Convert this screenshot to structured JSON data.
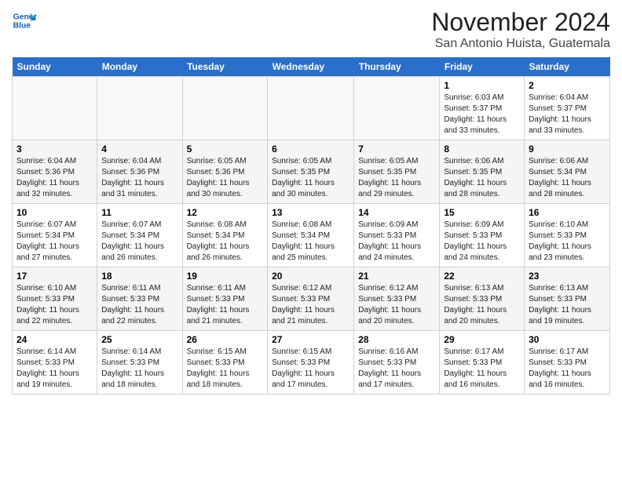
{
  "header": {
    "logo_line1": "General",
    "logo_line2": "Blue",
    "title": "November 2024",
    "subtitle": "San Antonio Huista, Guatemala"
  },
  "weekdays": [
    "Sunday",
    "Monday",
    "Tuesday",
    "Wednesday",
    "Thursday",
    "Friday",
    "Saturday"
  ],
  "weeks": [
    [
      {
        "day": "",
        "info": ""
      },
      {
        "day": "",
        "info": ""
      },
      {
        "day": "",
        "info": ""
      },
      {
        "day": "",
        "info": ""
      },
      {
        "day": "",
        "info": ""
      },
      {
        "day": "1",
        "info": "Sunrise: 6:03 AM\nSunset: 5:37 PM\nDaylight: 11 hours and 33 minutes."
      },
      {
        "day": "2",
        "info": "Sunrise: 6:04 AM\nSunset: 5:37 PM\nDaylight: 11 hours and 33 minutes."
      }
    ],
    [
      {
        "day": "3",
        "info": "Sunrise: 6:04 AM\nSunset: 5:36 PM\nDaylight: 11 hours and 32 minutes."
      },
      {
        "day": "4",
        "info": "Sunrise: 6:04 AM\nSunset: 5:36 PM\nDaylight: 11 hours and 31 minutes."
      },
      {
        "day": "5",
        "info": "Sunrise: 6:05 AM\nSunset: 5:36 PM\nDaylight: 11 hours and 30 minutes."
      },
      {
        "day": "6",
        "info": "Sunrise: 6:05 AM\nSunset: 5:35 PM\nDaylight: 11 hours and 30 minutes."
      },
      {
        "day": "7",
        "info": "Sunrise: 6:05 AM\nSunset: 5:35 PM\nDaylight: 11 hours and 29 minutes."
      },
      {
        "day": "8",
        "info": "Sunrise: 6:06 AM\nSunset: 5:35 PM\nDaylight: 11 hours and 28 minutes."
      },
      {
        "day": "9",
        "info": "Sunrise: 6:06 AM\nSunset: 5:34 PM\nDaylight: 11 hours and 28 minutes."
      }
    ],
    [
      {
        "day": "10",
        "info": "Sunrise: 6:07 AM\nSunset: 5:34 PM\nDaylight: 11 hours and 27 minutes."
      },
      {
        "day": "11",
        "info": "Sunrise: 6:07 AM\nSunset: 5:34 PM\nDaylight: 11 hours and 26 minutes."
      },
      {
        "day": "12",
        "info": "Sunrise: 6:08 AM\nSunset: 5:34 PM\nDaylight: 11 hours and 26 minutes."
      },
      {
        "day": "13",
        "info": "Sunrise: 6:08 AM\nSunset: 5:34 PM\nDaylight: 11 hours and 25 minutes."
      },
      {
        "day": "14",
        "info": "Sunrise: 6:09 AM\nSunset: 5:33 PM\nDaylight: 11 hours and 24 minutes."
      },
      {
        "day": "15",
        "info": "Sunrise: 6:09 AM\nSunset: 5:33 PM\nDaylight: 11 hours and 24 minutes."
      },
      {
        "day": "16",
        "info": "Sunrise: 6:10 AM\nSunset: 5:33 PM\nDaylight: 11 hours and 23 minutes."
      }
    ],
    [
      {
        "day": "17",
        "info": "Sunrise: 6:10 AM\nSunset: 5:33 PM\nDaylight: 11 hours and 22 minutes."
      },
      {
        "day": "18",
        "info": "Sunrise: 6:11 AM\nSunset: 5:33 PM\nDaylight: 11 hours and 22 minutes."
      },
      {
        "day": "19",
        "info": "Sunrise: 6:11 AM\nSunset: 5:33 PM\nDaylight: 11 hours and 21 minutes."
      },
      {
        "day": "20",
        "info": "Sunrise: 6:12 AM\nSunset: 5:33 PM\nDaylight: 11 hours and 21 minutes."
      },
      {
        "day": "21",
        "info": "Sunrise: 6:12 AM\nSunset: 5:33 PM\nDaylight: 11 hours and 20 minutes."
      },
      {
        "day": "22",
        "info": "Sunrise: 6:13 AM\nSunset: 5:33 PM\nDaylight: 11 hours and 20 minutes."
      },
      {
        "day": "23",
        "info": "Sunrise: 6:13 AM\nSunset: 5:33 PM\nDaylight: 11 hours and 19 minutes."
      }
    ],
    [
      {
        "day": "24",
        "info": "Sunrise: 6:14 AM\nSunset: 5:33 PM\nDaylight: 11 hours and 19 minutes."
      },
      {
        "day": "25",
        "info": "Sunrise: 6:14 AM\nSunset: 5:33 PM\nDaylight: 11 hours and 18 minutes."
      },
      {
        "day": "26",
        "info": "Sunrise: 6:15 AM\nSunset: 5:33 PM\nDaylight: 11 hours and 18 minutes."
      },
      {
        "day": "27",
        "info": "Sunrise: 6:15 AM\nSunset: 5:33 PM\nDaylight: 11 hours and 17 minutes."
      },
      {
        "day": "28",
        "info": "Sunrise: 6:16 AM\nSunset: 5:33 PM\nDaylight: 11 hours and 17 minutes."
      },
      {
        "day": "29",
        "info": "Sunrise: 6:17 AM\nSunset: 5:33 PM\nDaylight: 11 hours and 16 minutes."
      },
      {
        "day": "30",
        "info": "Sunrise: 6:17 AM\nSunset: 5:33 PM\nDaylight: 11 hours and 16 minutes."
      }
    ]
  ]
}
